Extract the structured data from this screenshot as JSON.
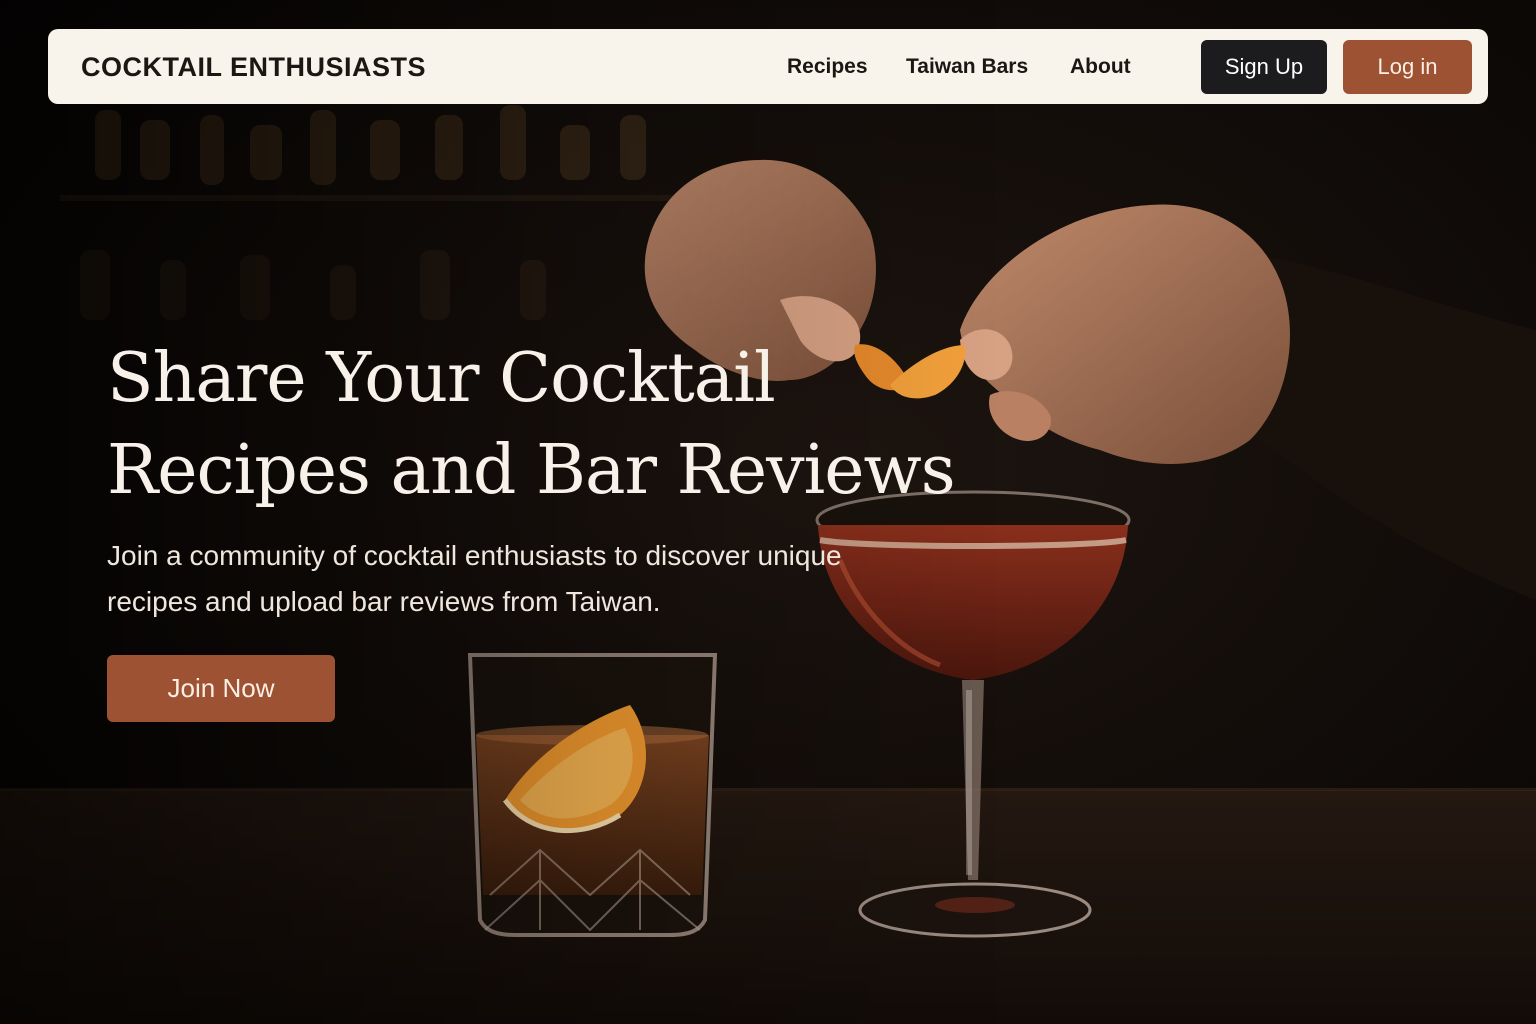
{
  "navbar": {
    "brand": "COCKTAIL ENTHUSIASTS",
    "links": [
      "Recipes",
      "Taiwan Bars",
      "About"
    ],
    "signup_label": "Sign Up",
    "login_label": "Log in"
  },
  "hero": {
    "title": "Share Your Cocktail Recipes and Bar Reviews",
    "subtitle": "Join a community of cocktail enthusiasts to discover unique recipes and upload bar reviews from Taiwan.",
    "cta_label": "Join Now"
  },
  "colors": {
    "accent": "#9d5233",
    "dark_button": "#1c1c1e",
    "navbar_bg": "#f8f3eb",
    "hero_text": "#f7f1ea"
  }
}
